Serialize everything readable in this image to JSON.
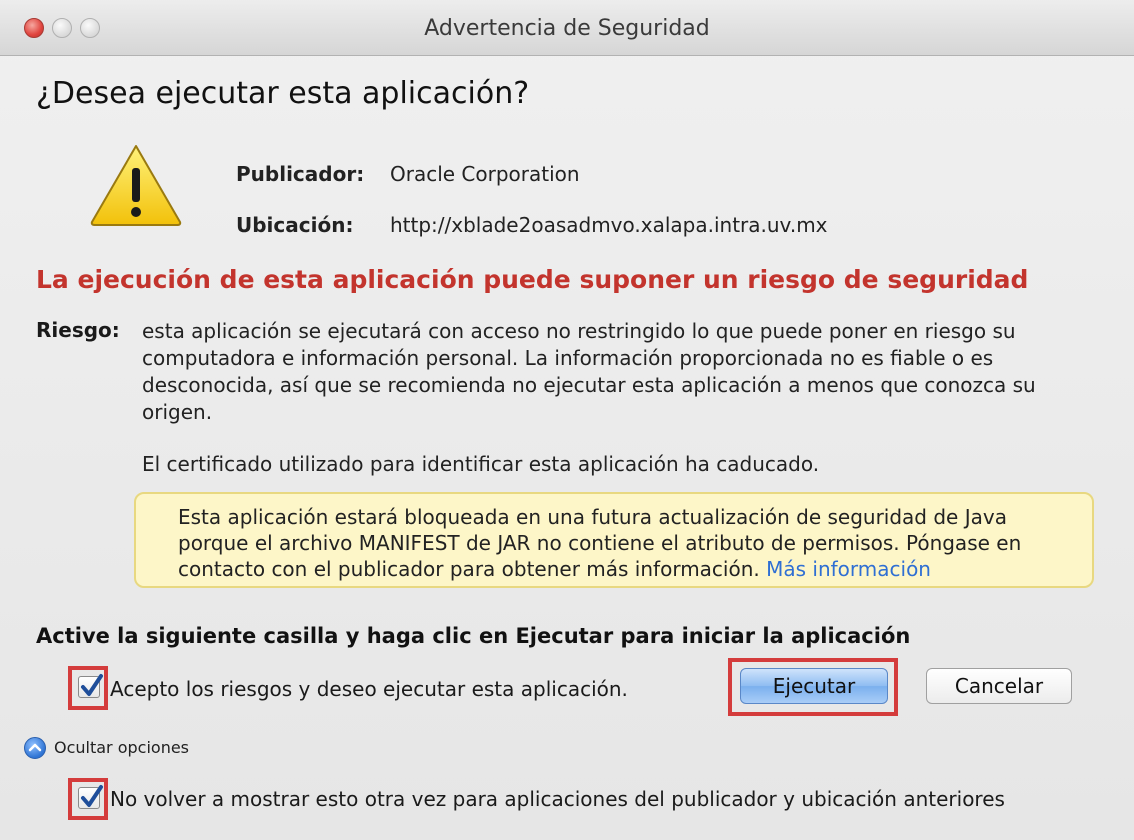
{
  "window": {
    "title": "Advertencia de Seguridad"
  },
  "dialog": {
    "heading": "¿Desea ejecutar esta aplicación?",
    "publisher_label": "Publicador:",
    "publisher_value": "Oracle Corporation",
    "location_label": "Ubicación:",
    "location_value": "http://xblade2oasadmvo.xalapa.intra.uv.mx",
    "risk_title": "La ejecución de esta aplicación puede suponer un riesgo de seguridad",
    "risk_label": "Riesgo:",
    "risk_text": "esta aplicación se ejecutará con acceso no restringido lo que puede poner en riesgo su computadora e información personal. La información proporcionada no es fiable o es desconocida, así que se recomienda no ejecutar esta aplicación a menos que conozca su origen.",
    "cert_text": "El certificado utilizado para identificar esta aplicación ha caducado.",
    "notice_text": "Esta aplicación estará bloqueada en una futura actualización de seguridad de Java porque el archivo MANIFEST de JAR no contiene el atributo de permisos. Póngase en contacto con el publicador para obtener más información.",
    "notice_link": "Más información",
    "instruction": "Active la siguiente casilla y haga clic en Ejecutar para iniciar la aplicación",
    "accept_label": "Acepto los riesgos y deseo ejecutar esta aplicación.",
    "accept_checked": true,
    "run_button": "Ejecutar",
    "cancel_button": "Cancelar",
    "options_toggle": "Ocultar opciones",
    "dont_show_label": "No volver a mostrar esto otra vez para aplicaciones del publicador y ubicación anteriores",
    "dont_show_checked": true
  },
  "icons": {
    "warning": "warning-triangle-icon",
    "checkmark": "checkmark-icon",
    "disclosure": "chevron-up-icon"
  },
  "colors": {
    "risk_title": "#c3342d",
    "highlight_outline": "#d43c3c",
    "notice_background": "#fdf6c8",
    "link": "#2f6fd3"
  }
}
